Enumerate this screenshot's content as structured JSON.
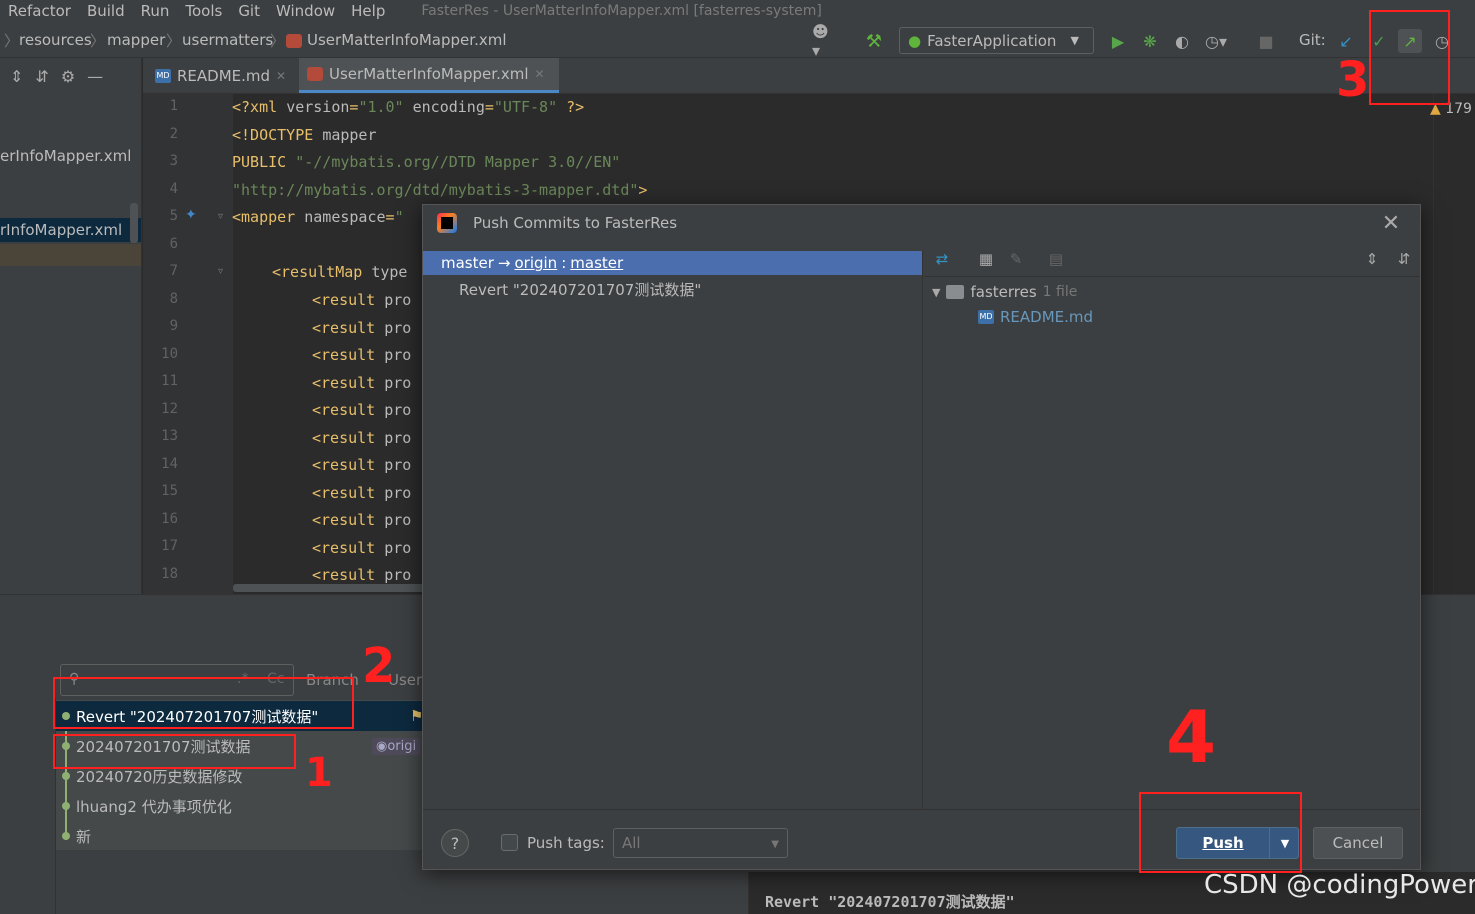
{
  "window": {
    "title": "FasterRes - UserMatterInfoMapper.xml [fasterres-system]",
    "menu": [
      "Refactor",
      "Build",
      "Run",
      "Tools",
      "Git",
      "Window",
      "Help"
    ]
  },
  "breadcrumb": {
    "items": [
      "resources",
      "mapper",
      "usermatters",
      "UserMatterInfoMapper.xml"
    ]
  },
  "toolbar": {
    "run_config": "FasterApplication",
    "git_label": "Git:"
  },
  "tabs": [
    {
      "label": "README.md",
      "active": false
    },
    {
      "label": "UserMatterInfoMapper.xml",
      "active": true
    }
  ],
  "project_panel": {
    "item1": "erInfoMapper.xml",
    "item2": "rInfoMapper.xml"
  },
  "editor": {
    "warning_count": "179",
    "line_numbers": [
      "1",
      "2",
      "3",
      "4",
      "5",
      "6",
      "7",
      "8",
      "9",
      "10",
      "11",
      "12",
      "13",
      "14",
      "15",
      "16",
      "17",
      "18"
    ]
  },
  "git_log": {
    "search_placeholder": "",
    "filter_branch": "Branch",
    "filter_user": "User",
    "commits": [
      {
        "message": "Revert \"202407201707测试数据\"",
        "tag": ""
      },
      {
        "message": "202407201707测试数据",
        "tag": "origi"
      },
      {
        "message": "20240720历史数据修改",
        "tag": ""
      },
      {
        "message": "lhuang2 代办事项优化",
        "tag": ""
      },
      {
        "message": "新",
        "tag": ""
      }
    ],
    "detail": "Revert \"202407201707测试数据\""
  },
  "dialog": {
    "title": "Push Commits to FasterRes",
    "branch_local": "master",
    "arrow": "→",
    "remote": "origin",
    "separator": ":",
    "branch_remote": "master",
    "commit": "Revert \"202407201707测试数据\"",
    "tree_root": "fasterres",
    "tree_root_count": "1 file",
    "tree_file": "README.md",
    "help_label": "?",
    "push_tags_label": "Push tags:",
    "push_tags_value": "All",
    "push_label": "Push",
    "cancel_label": "Cancel"
  },
  "annotations": {
    "step1": "1",
    "step2": "2",
    "step3": "3",
    "step4": "4"
  },
  "watermark": "CSDN @codingPower",
  "colors": {
    "selection": "#4b6eaf",
    "annotation_red": "#ff2020",
    "push_button": "#365880"
  }
}
